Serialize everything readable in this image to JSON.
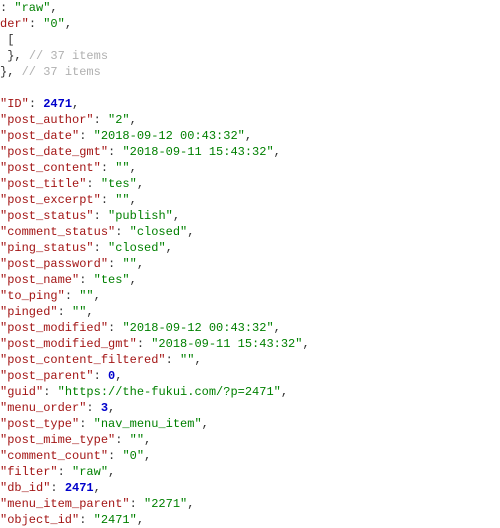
{
  "lines": [
    {
      "text": ": ",
      "key": null,
      "valType": "str",
      "val": "raw",
      "tail": ","
    },
    {
      "keytext": "der",
      "valType": "str",
      "val": "0",
      "tail": ","
    },
    {
      "raw": " ["
    },
    {
      "raw": " }, ",
      "comment": "// 37 items"
    },
    {
      "raw": "}, ",
      "comment": "// 37 items"
    },
    {
      "blank": true
    },
    {
      "key": "ID",
      "valType": "num",
      "val": "2471",
      "tail": ","
    },
    {
      "key": "post_author",
      "valType": "str",
      "val": "2",
      "tail": ","
    },
    {
      "key": "post_date",
      "valType": "str",
      "val": "2018-09-12 00:43:32",
      "tail": ","
    },
    {
      "key": "post_date_gmt",
      "valType": "str",
      "val": "2018-09-11 15:43:32",
      "tail": ","
    },
    {
      "key": "post_content",
      "valType": "str",
      "val": "",
      "tail": ","
    },
    {
      "key": "post_title",
      "valType": "str",
      "val": "tes",
      "tail": ","
    },
    {
      "key": "post_excerpt",
      "valType": "str",
      "val": "",
      "tail": ","
    },
    {
      "key": "post_status",
      "valType": "str",
      "val": "publish",
      "tail": ","
    },
    {
      "key": "comment_status",
      "valType": "str",
      "val": "closed",
      "tail": ","
    },
    {
      "key": "ping_status",
      "valType": "str",
      "val": "closed",
      "tail": ","
    },
    {
      "key": "post_password",
      "valType": "str",
      "val": "",
      "tail": ","
    },
    {
      "key": "post_name",
      "valType": "str",
      "val": "tes",
      "tail": ","
    },
    {
      "key": "to_ping",
      "valType": "str",
      "val": "",
      "tail": ","
    },
    {
      "key": "pinged",
      "valType": "str",
      "val": "",
      "tail": ","
    },
    {
      "key": "post_modified",
      "valType": "str",
      "val": "2018-09-12 00:43:32",
      "tail": ","
    },
    {
      "key": "post_modified_gmt",
      "valType": "str",
      "val": "2018-09-11 15:43:32",
      "tail": ","
    },
    {
      "key": "post_content_filtered",
      "valType": "str",
      "val": "",
      "tail": ","
    },
    {
      "key": "post_parent",
      "valType": "num",
      "val": "0",
      "tail": ","
    },
    {
      "key": "guid",
      "valType": "str",
      "val": "https://the-fukui.com/?p=2471",
      "tail": ","
    },
    {
      "key": "menu_order",
      "valType": "num",
      "val": "3",
      "tail": ","
    },
    {
      "key": "post_type",
      "valType": "str",
      "val": "nav_menu_item",
      "tail": ","
    },
    {
      "key": "post_mime_type",
      "valType": "str",
      "val": "",
      "tail": ","
    },
    {
      "key": "comment_count",
      "valType": "str",
      "val": "0",
      "tail": ","
    },
    {
      "key": "filter",
      "valType": "str",
      "val": "raw",
      "tail": ","
    },
    {
      "key": "db_id",
      "valType": "num",
      "val": "2471",
      "tail": ","
    },
    {
      "key": "menu_item_parent",
      "valType": "str",
      "val": "2271",
      "tail": ","
    },
    {
      "key": "object_id",
      "valType": "str",
      "val": "2471",
      "tail": ","
    }
  ]
}
